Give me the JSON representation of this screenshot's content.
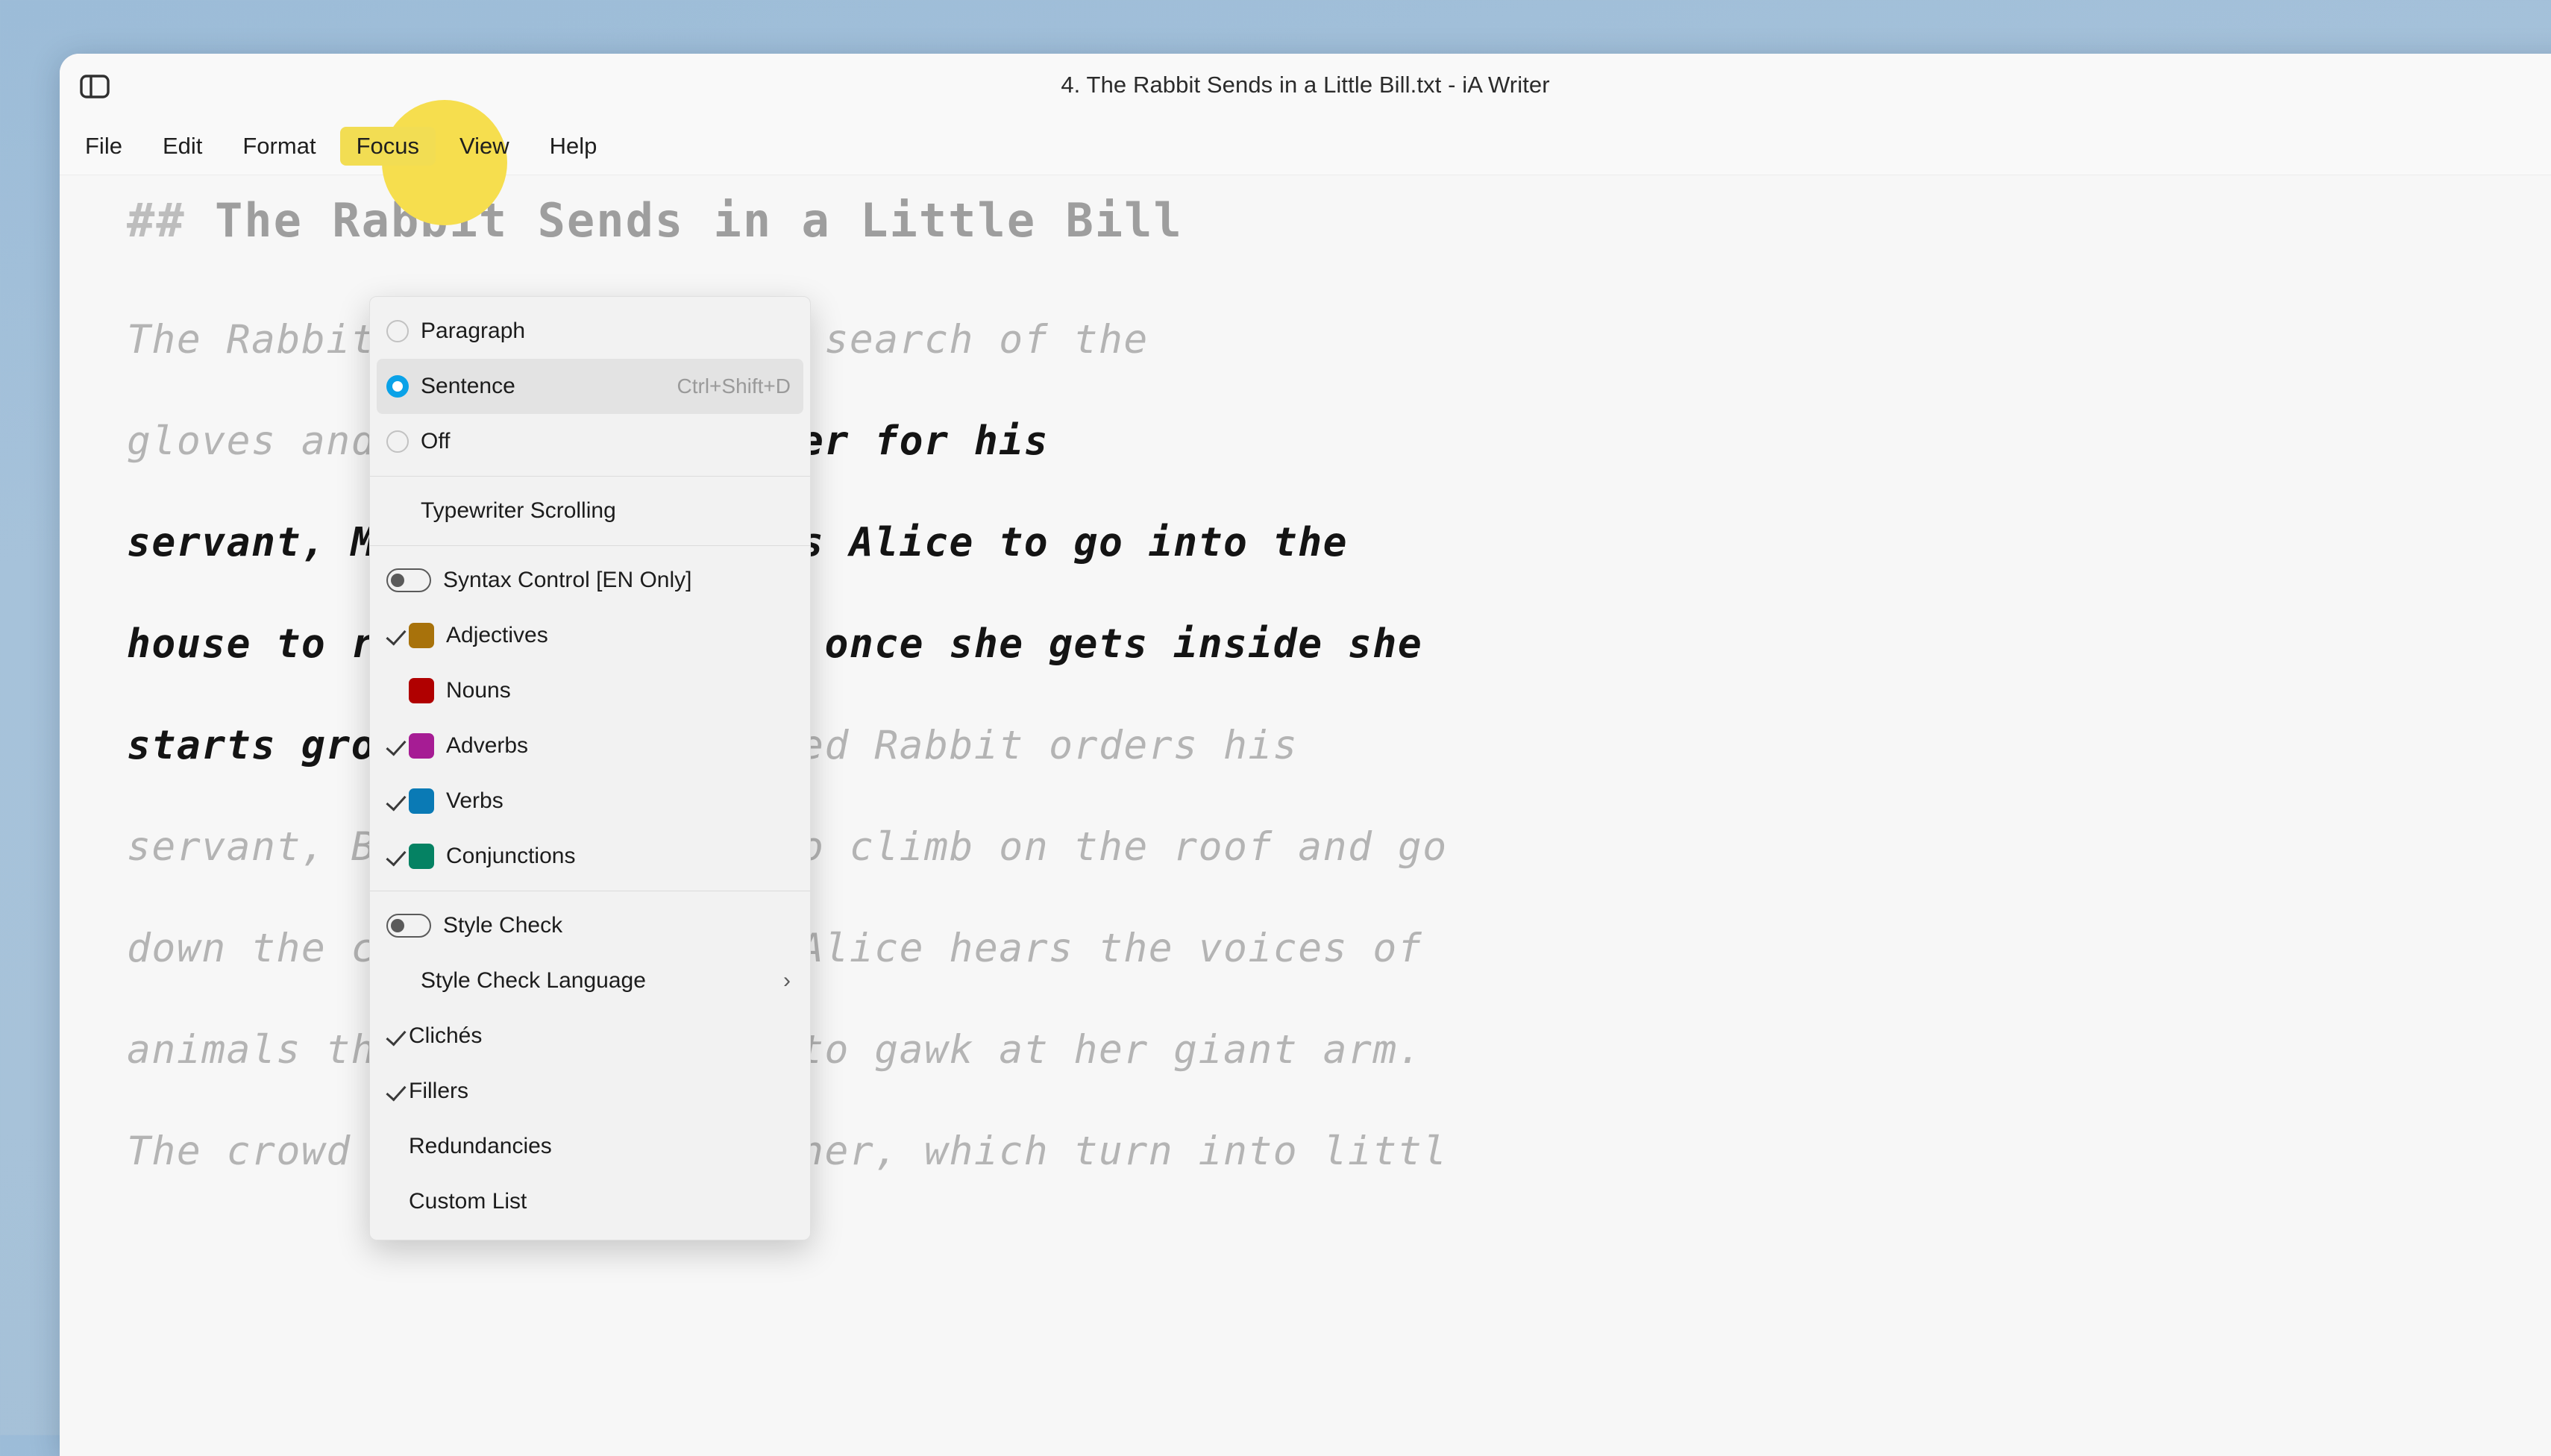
{
  "window": {
    "title": "4. The Rabbit Sends in a Little Bill.txt - iA Writer",
    "sidebar_toggle_icon": "sidebar-toggle-icon"
  },
  "menubar": {
    "items": [
      {
        "label": "File",
        "active": false
      },
      {
        "label": "Edit",
        "active": false
      },
      {
        "label": "Format",
        "active": false
      },
      {
        "label": "Focus",
        "active": true
      },
      {
        "label": "View",
        "active": false
      },
      {
        "label": "Help",
        "active": false
      }
    ],
    "highlight_color": "#f6de4e"
  },
  "focus_menu": {
    "focus_mode": {
      "options": [
        {
          "label": "Paragraph",
          "selected": false,
          "accel": ""
        },
        {
          "label": "Sentence",
          "selected": true,
          "accel": "Ctrl+Shift+D"
        },
        {
          "label": "Off",
          "selected": false,
          "accel": ""
        }
      ],
      "radio_color": "#0aa2e8"
    },
    "typewriter": {
      "label": "Typewriter Scrolling"
    },
    "syntax": {
      "toggle": {
        "label": "Syntax Control [EN Only]",
        "on": false
      },
      "parts_of_speech": [
        {
          "label": "Adjectives",
          "checked": true,
          "color": "#a8720b"
        },
        {
          "label": "Nouns",
          "checked": false,
          "color": "#b00000"
        },
        {
          "label": "Adverbs",
          "checked": true,
          "color": "#a61c94"
        },
        {
          "label": "Verbs",
          "checked": true,
          "color": "#0a7ab5"
        },
        {
          "label": "Conjunctions",
          "checked": true,
          "color": "#058263"
        }
      ]
    },
    "style_check": {
      "toggle": {
        "label": "Style Check",
        "on": false
      },
      "language": {
        "label": "Style Check Language",
        "submenu_icon": "chevron-right-icon"
      },
      "rules": [
        {
          "label": "Clichés",
          "checked": true
        },
        {
          "label": "Fillers",
          "checked": true
        },
        {
          "label": "Redundancies",
          "checked": false
        },
        {
          "label": "Custom List",
          "checked": false
        }
      ]
    }
  },
  "document": {
    "heading_hash": "##",
    "heading_text": "The Rabbit Sends in a Little Bill",
    "lines": [
      {
        "dim": "The Rabbit appears again in search of the",
        "focus": ""
      },
      {
        "dim": "gloves and fan.",
        "focus": " Mistaking her for his"
      },
      {
        "dim": "",
        "focus": "servant, Mary Ann, he orders Alice to go into the"
      },
      {
        "dim": "",
        "focus": "house to retrieve them, but once she gets inside she"
      },
      {
        "dim": "",
        "focus": "starts growing."
      },
      {
        "dim": " The horrified Rabbit orders his",
        "focus": ""
      },
      {
        "dim": "servant, Bill the Lizard, to climb on the roof and go",
        "focus": ""
      },
      {
        "dim": "down the chimney. Outside, Alice hears the voices of",
        "focus": ""
      },
      {
        "dim": "animals that have gathered to gawk at her giant arm.",
        "focus": ""
      },
      {
        "dim": "The crowd hurls pebbles at her, which turn into littl",
        "focus": ""
      }
    ]
  }
}
